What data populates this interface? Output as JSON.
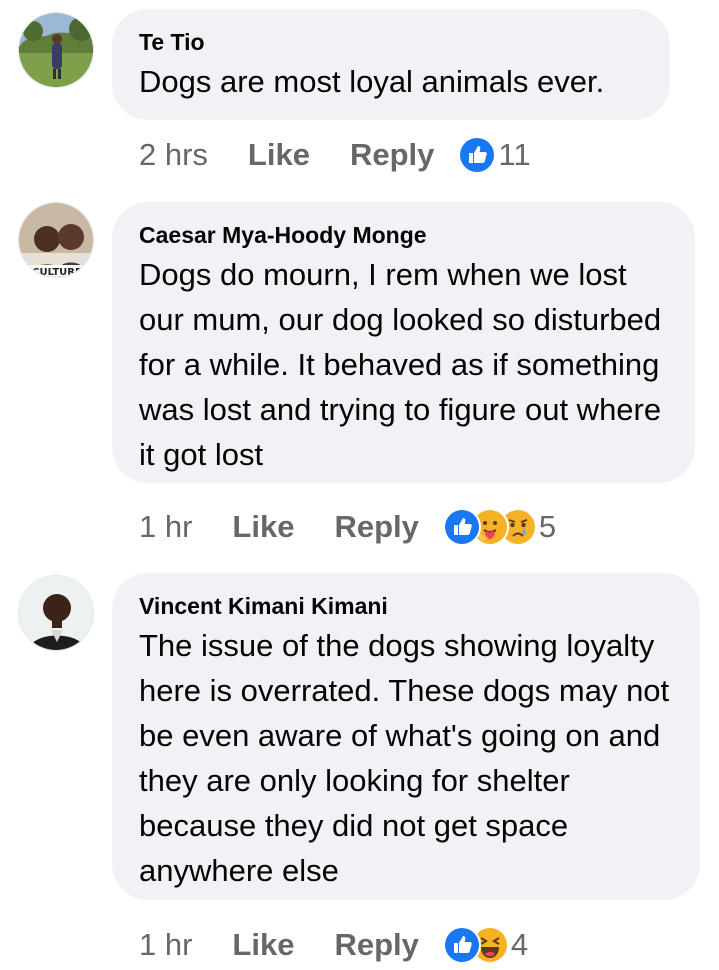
{
  "comments": [
    {
      "author": "Te Tio",
      "text": "Dogs are most loyal animals ever.",
      "time": "2 hrs",
      "like_label": "Like",
      "reply_label": "Reply",
      "reactions": [
        "like-icon"
      ],
      "reaction_count": "11"
    },
    {
      "author": "Caesar Mya-Hoody Monge",
      "avatar_badge": "CULTURE",
      "text": "Dogs do mourn, I rem when we lost our mum,  our dog looked so disturbed for a while. It behaved as if something was lost and trying to figure out where it got lost",
      "time": "1 hr",
      "like_label": "Like",
      "reply_label": "Reply",
      "reactions": [
        "like-icon",
        "care-icon",
        "sad-icon"
      ],
      "reaction_count": "5"
    },
    {
      "author": "Vincent Kimani Kimani",
      "text": "The issue of the dogs showing loyalty here is overrated. These dogs may not be even aware of what's going on and they are only looking for shelter because they did not get space anywhere else",
      "time": "1 hr",
      "like_label": "Like",
      "reply_label": "Reply",
      "reactions": [
        "like-icon",
        "haha-icon"
      ],
      "reaction_count": "4"
    }
  ],
  "colors": {
    "bubble": "#f0f2f5",
    "meta_text": "#65676b",
    "like_blue": "#1877f2",
    "reaction_yellow": "#f7b125"
  }
}
